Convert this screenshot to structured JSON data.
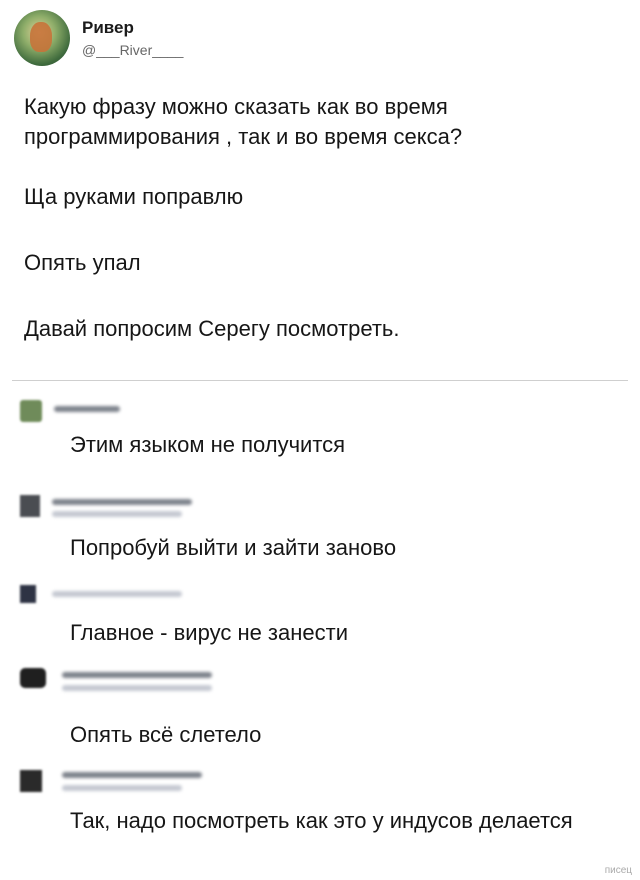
{
  "author": {
    "name": "Ривер",
    "handle": "@___River____"
  },
  "post": {
    "paragraphs": [
      "Какую фразу можно сказать как во время программирования , так и во время секса?",
      "Ща руками поправлю",
      "Опять упал",
      "Давай попросим Серегу посмотреть."
    ]
  },
  "replies": [
    {
      "text": "Этим языком не получится"
    },
    {
      "text": "Попробуй выйти и зайти заново"
    },
    {
      "text": "Главное - вирус не занести"
    },
    {
      "text": "Опять всё слетело"
    },
    {
      "text": "Так, надо посмотреть как это у индусов делается"
    }
  ],
  "watermark": "писец"
}
